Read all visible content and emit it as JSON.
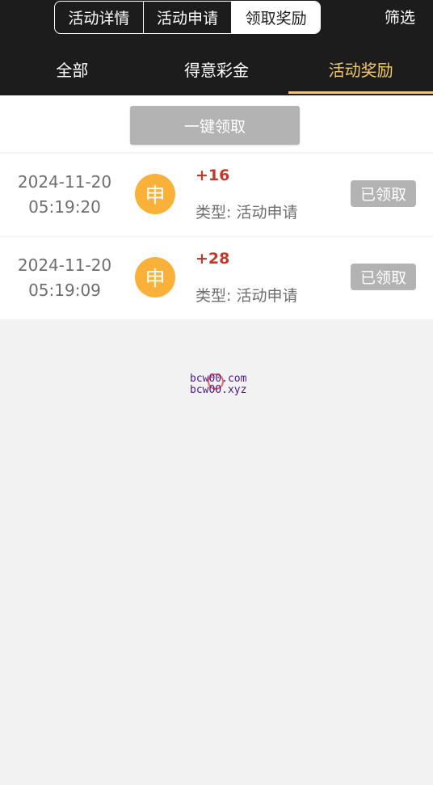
{
  "segments": [
    {
      "label": "活动详情",
      "active": false
    },
    {
      "label": "活动申请",
      "active": false
    },
    {
      "label": "领取奖励",
      "active": true
    }
  ],
  "filter_label": "筛选",
  "tabs": [
    {
      "label": "全部",
      "active": false
    },
    {
      "label": "得意彩金",
      "active": false
    },
    {
      "label": "活动奖励",
      "active": true
    }
  ],
  "claim_all_label": "一键领取",
  "records": [
    {
      "date": "2024-11-20",
      "time": "05:19:20",
      "badge": "申",
      "amount": "+16",
      "type": "类型: 活动申请",
      "status": "已领取"
    },
    {
      "date": "2024-11-20",
      "time": "05:19:09",
      "badge": "申",
      "amount": "+28",
      "type": "类型: 活动申请",
      "status": "已领取"
    }
  ],
  "watermark": {
    "line1": "bcw00.com",
    "line2": "bcwOO.xyz"
  },
  "colors": {
    "header_bg": "#1c1c1c",
    "accent": "#f2c86a",
    "badge": "#f9b13a",
    "amount": "#c0392b",
    "disabled": "#b3b3b3"
  }
}
